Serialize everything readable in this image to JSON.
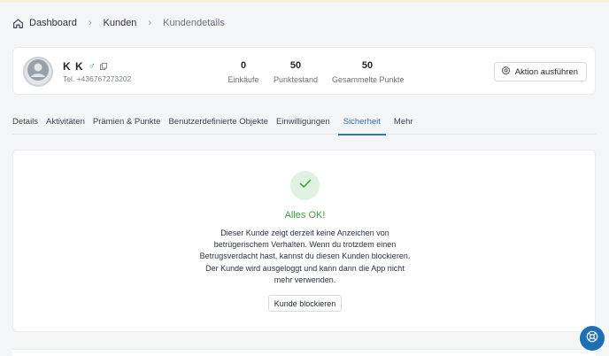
{
  "breadcrumb": {
    "items": [
      "Dashboard",
      "Kunden",
      "Kundendetails"
    ]
  },
  "customer": {
    "name": "K K",
    "gender_symbol": "♂",
    "phone": "Tel. +436767273202",
    "stats": [
      {
        "value": "0",
        "label": "Einkäufe"
      },
      {
        "value": "50",
        "label": "Punktestand"
      },
      {
        "value": "50",
        "label": "Gesammelte Punkte"
      }
    ],
    "action_label": "Aktion ausführen"
  },
  "tabs": [
    {
      "label": "Details",
      "active": false
    },
    {
      "label": "Aktivitäten",
      "active": false
    },
    {
      "label": "Prämien & Punkte",
      "active": false
    },
    {
      "label": "Benutzerdefinierte Objekte",
      "active": false
    },
    {
      "label": "Einwilligungen",
      "active": false
    },
    {
      "label": "Sicherheit",
      "active": true
    },
    {
      "label": "Mehr",
      "active": false
    }
  ],
  "security": {
    "status_title": "Alles OK!",
    "message_lines": [
      "Dieser Kunde zeigt derzeit keine Anzeichen von",
      "betrügerischem Verhalten. Wenn du trotzdem einen",
      "Betrugsverdacht hast, kannst du diesen Kunden blockieren.",
      "Der Kunde wird ausgeloggt und kann dann die App nicht",
      "mehr verwenden."
    ],
    "block_label": "Kunde blockieren"
  },
  "colors": {
    "accent": "#2f7ac0",
    "success": "#43a047",
    "success_bg": "#dff1e0",
    "fab": "#1e6fb3"
  },
  "icons": [
    "home-icon",
    "chevron-right-icon",
    "avatar-icon",
    "male-icon",
    "copy-icon",
    "gear-icon",
    "checkmark-icon",
    "help-icon"
  ]
}
